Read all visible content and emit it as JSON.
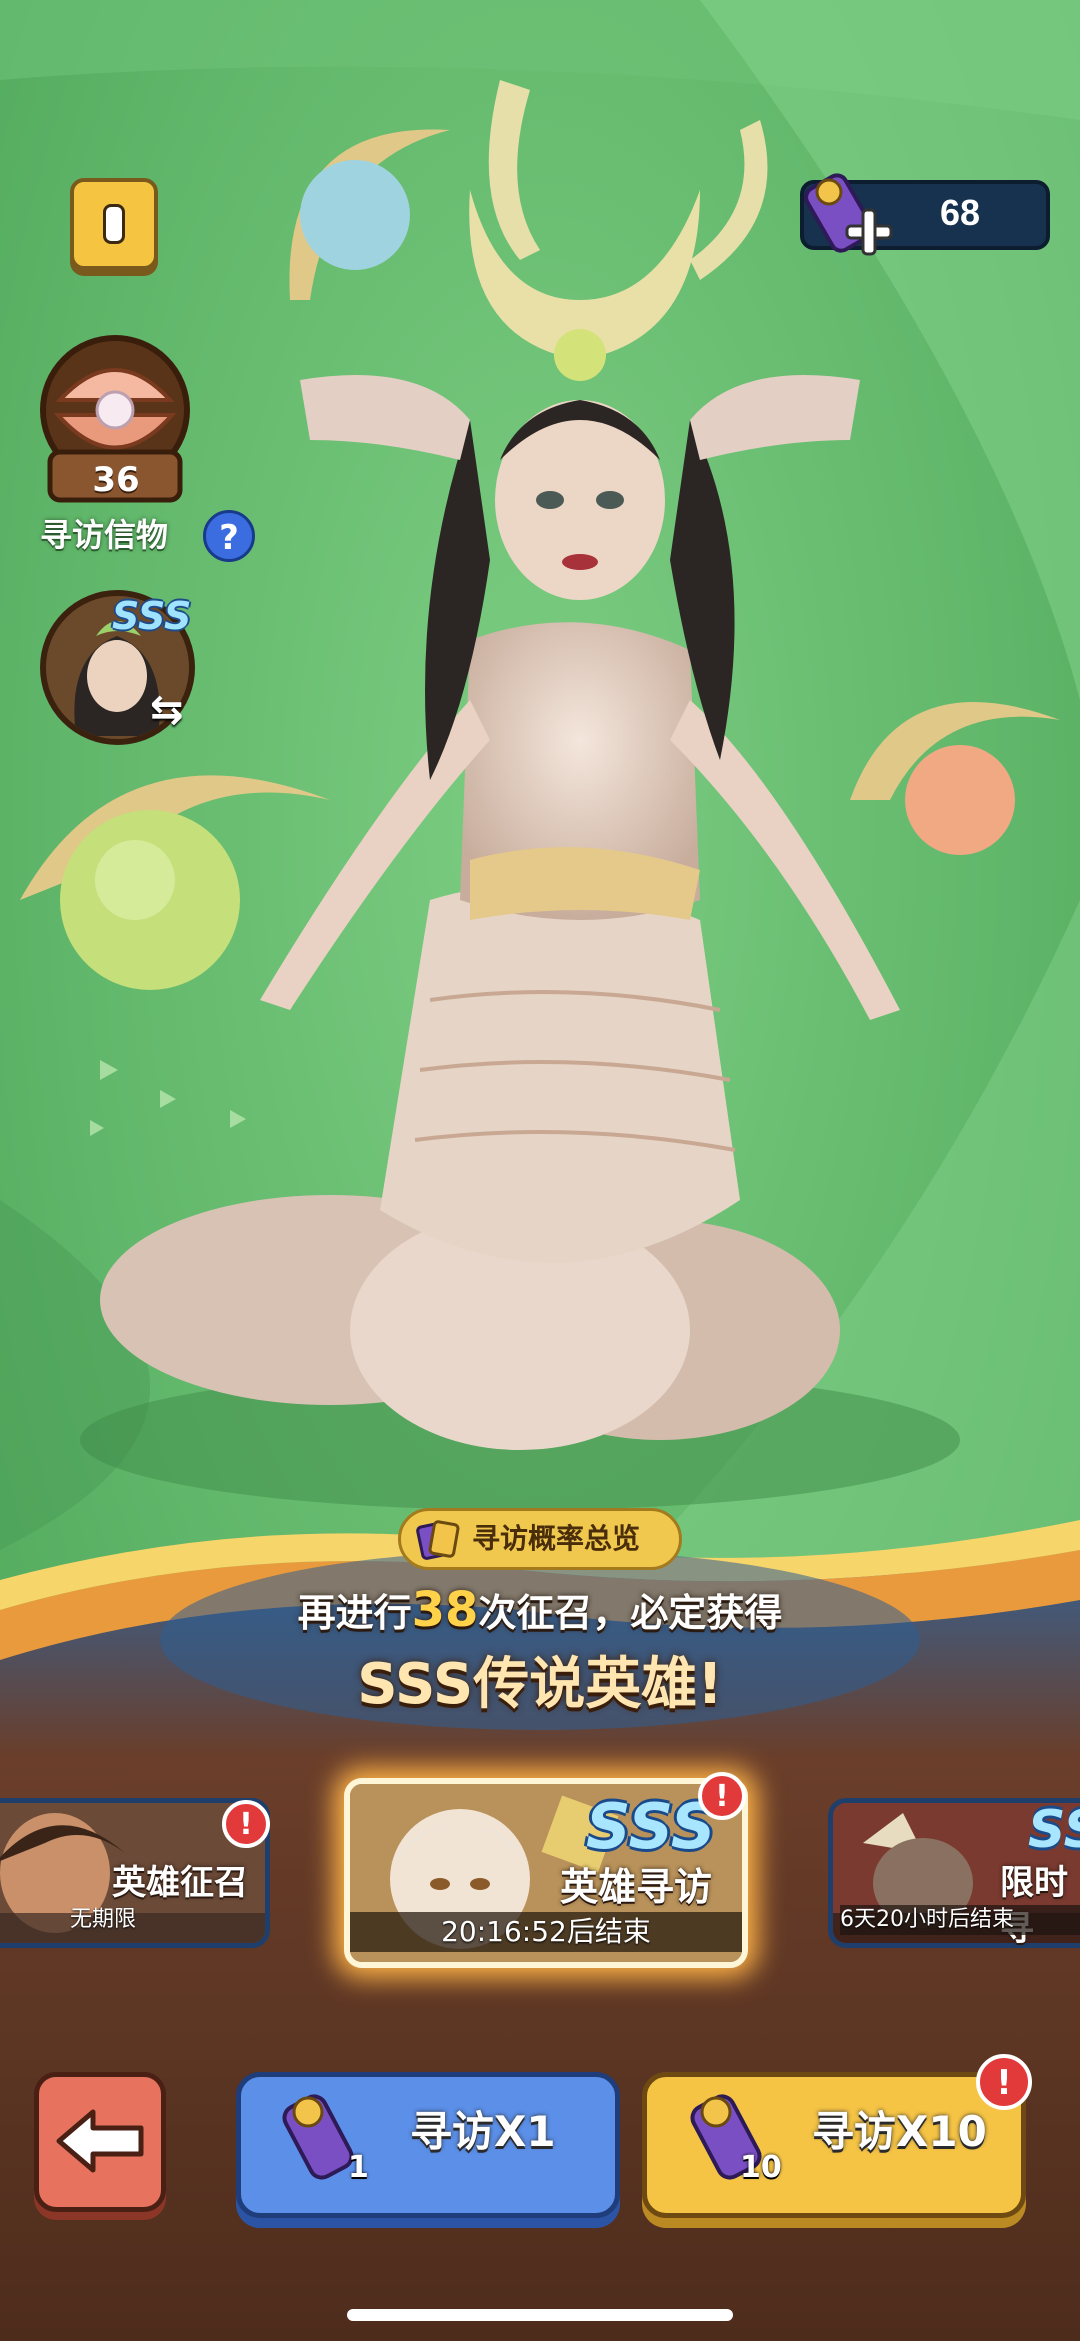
{
  "top": {
    "currency_value": "68"
  },
  "side": {
    "item_count": "36",
    "item_label": "寻访信物",
    "help_glyph": "?",
    "hero_rank": "SSS",
    "swap_glyph": "⇆"
  },
  "banner": {
    "rate_overview": "寻访概率总览",
    "guarantee_prefix": "再进行",
    "guarantee_count": "38",
    "guarantee_suffix": "次征召，必定获得",
    "guarantee_reward": "SSS传说英雄!"
  },
  "cards": [
    {
      "title": "英雄征召",
      "subtitle": "无期限"
    },
    {
      "title": "英雄寻访",
      "subtitle": "20:16:52后结束",
      "rank": "SSS"
    },
    {
      "title": "限时寻",
      "subtitle": "6天20小时后结束",
      "rank": "SS"
    }
  ],
  "buttons": {
    "search_one": "寻访X1",
    "search_one_cost": "1",
    "search_ten": "寻访X10",
    "search_ten_cost": "10",
    "alert_glyph": "!"
  },
  "colors": {
    "background_green": "#5fb86a",
    "lower_brown": "#5b3422",
    "blue_button": "#5b8fe8",
    "gold_button": "#f5c445",
    "back_button": "#e7735f"
  }
}
